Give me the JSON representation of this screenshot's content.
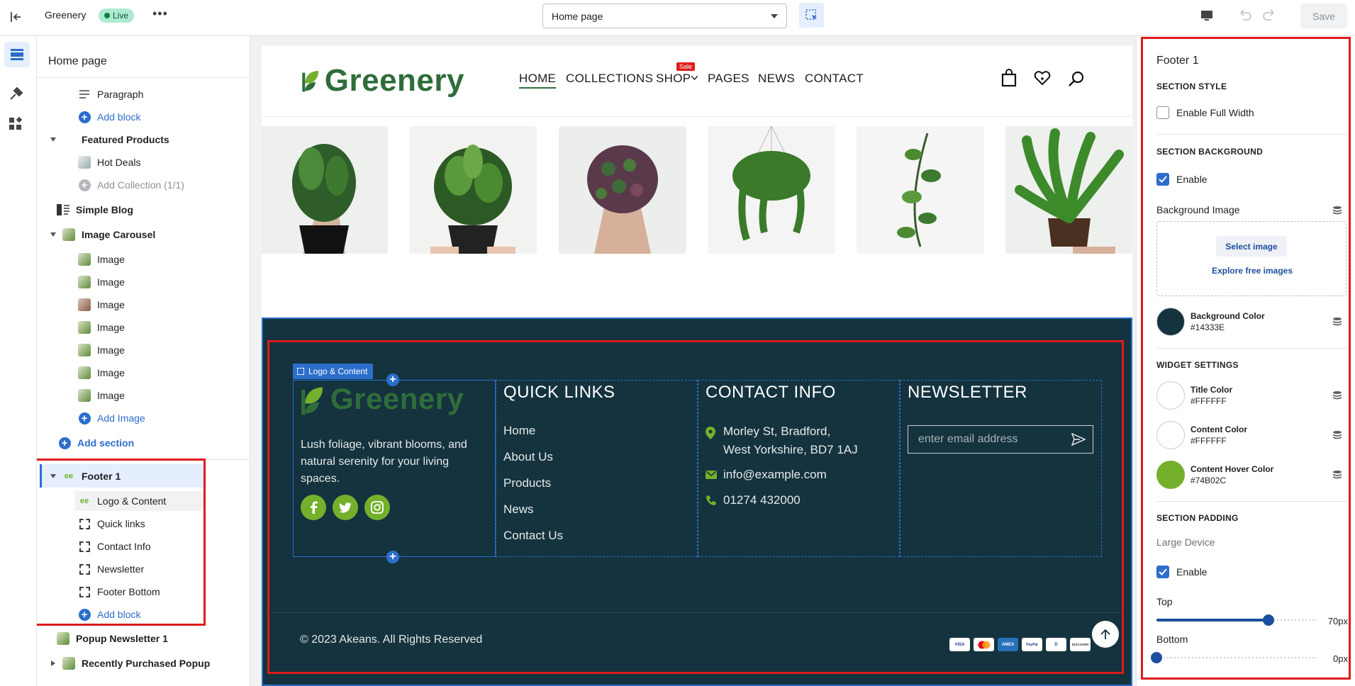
{
  "topbar": {
    "store_name": "Greenery",
    "status_badge": "Live",
    "page_select": "Home page",
    "save_label": "Save"
  },
  "left_panel": {
    "title": "Home page",
    "items": [
      {
        "label": "Paragraph"
      },
      {
        "label": "Add block"
      },
      {
        "label": "Featured Products"
      },
      {
        "label": "Hot Deals"
      },
      {
        "label": "Add Collection (1/1)"
      },
      {
        "label": "Simple Blog"
      },
      {
        "label": "Image Carousel"
      },
      {
        "label": "Image"
      },
      {
        "label": "Image"
      },
      {
        "label": "Image"
      },
      {
        "label": "Image"
      },
      {
        "label": "Image"
      },
      {
        "label": "Image"
      },
      {
        "label": "Image"
      },
      {
        "label": "Add Image"
      },
      {
        "label": "Add section"
      },
      {
        "label": "Footer 1"
      },
      {
        "label": "Logo & Content"
      },
      {
        "label": "Quick links"
      },
      {
        "label": "Contact Info"
      },
      {
        "label": "Newsletter"
      },
      {
        "label": "Footer Bottom"
      },
      {
        "label": "Add block"
      },
      {
        "label": "Popup Newsletter 1"
      },
      {
        "label": "Recently Purchased Popup"
      }
    ]
  },
  "site": {
    "logo_text": "Greenery",
    "nav": [
      "HOME",
      "COLLECTIONS",
      "SHOP",
      "PAGES",
      "NEWS",
      "CONTACT"
    ],
    "sale_badge": "Sale",
    "block_label": "Logo & Content",
    "footer": {
      "about_text": "Lush foliage, vibrant blooms, and natural serenity for your living spaces.",
      "quick_links_title": "QUICK LINKS",
      "quick_links": [
        "Home",
        "About Us",
        "Products",
        "News",
        "Contact Us"
      ],
      "contact_title": "CONTACT INFO",
      "address_line1": "Morley St, Bradford,",
      "address_line2": "West Yorkshire, BD7 1AJ",
      "email": "info@example.com",
      "phone": "01274 432000",
      "newsletter_title": "NEWSLETTER",
      "email_placeholder": "enter email address",
      "copyright": "© 2023 Akeans. All Rights Reserved",
      "payments": [
        "VISA",
        "MC",
        "AMEX",
        "PayPal",
        "D",
        "DISCOVER"
      ]
    }
  },
  "settings": {
    "title": "Footer 1",
    "section_style": "SECTION STYLE",
    "enable_full_width": "Enable Full Width",
    "section_background": "SECTION BACKGROUND",
    "enable": "Enable",
    "background_image": "Background Image",
    "select_image": "Select image",
    "explore_images": "Explore free images",
    "bg_color_label": "Background Color",
    "bg_color_value": "#14333E",
    "widget_settings": "WIDGET SETTINGS",
    "title_color_label": "Title Color",
    "title_color_value": "#FFFFFF",
    "content_color_label": "Content Color",
    "content_color_value": "#FFFFFF",
    "hover_color_label": "Content Hover Color",
    "hover_color_value": "#74B02C",
    "section_padding": "SECTION PADDING",
    "large_device": "Large Device",
    "enable_padding": "Enable",
    "top_label": "Top",
    "top_value": "70px",
    "top_fraction": 0.7,
    "bottom_label": "Bottom",
    "bottom_value": "0px",
    "bottom_fraction": 0
  },
  "colors": {
    "accent": "#2c6ecb",
    "footer_bg": "#14333E",
    "brand_green": "#74B02C",
    "highlight": "#e01b1b"
  }
}
